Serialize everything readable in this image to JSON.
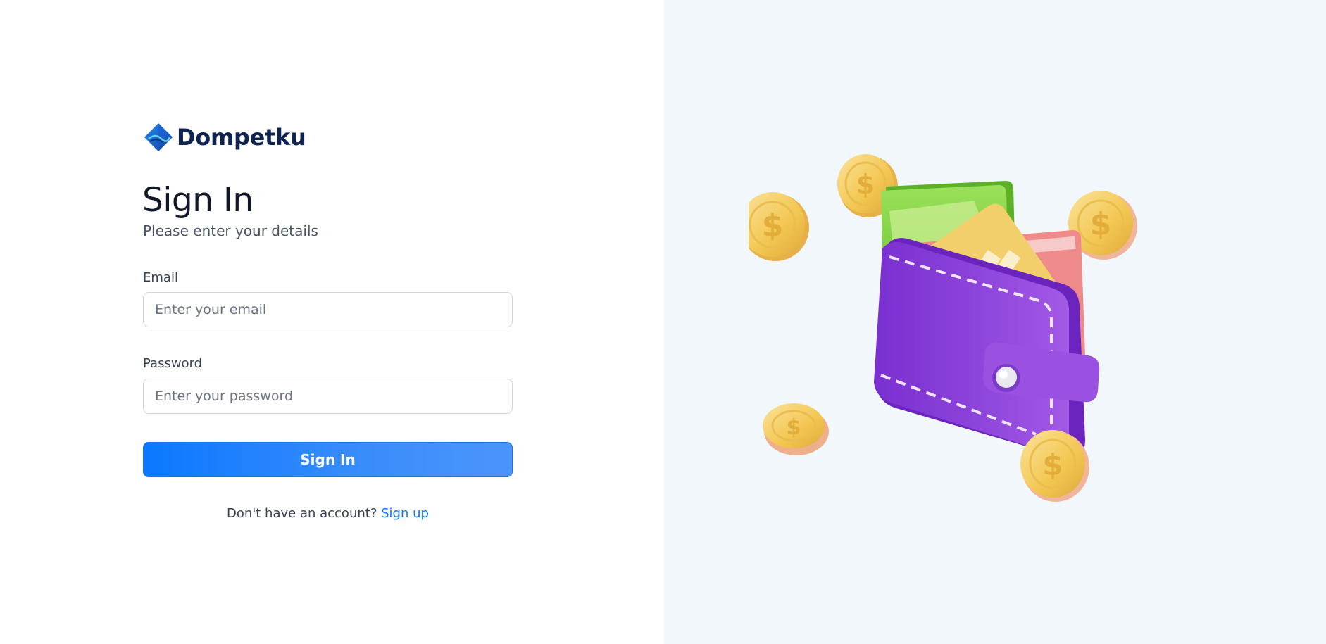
{
  "brand": {
    "name": "Dompetku",
    "logo_icon": "diamond-logo-icon"
  },
  "form": {
    "title": "Sign In",
    "subtitle": "Please enter your details",
    "email": {
      "label": "Email",
      "value": "",
      "placeholder": "Enter your email"
    },
    "password": {
      "label": "Password",
      "value": "",
      "placeholder": "Enter your password"
    },
    "submit_label": "Sign In",
    "signup_prompt": "Don't have an account?",
    "signup_link": "Sign up"
  },
  "illustration": {
    "icon": "wallet-with-coins-illustration"
  },
  "colors": {
    "primary": "#0b78ff",
    "brand_text": "#0f2350",
    "right_background": "#f2f7fc",
    "wallet": "#8b3fd6",
    "coin": "#f2cc5a"
  }
}
